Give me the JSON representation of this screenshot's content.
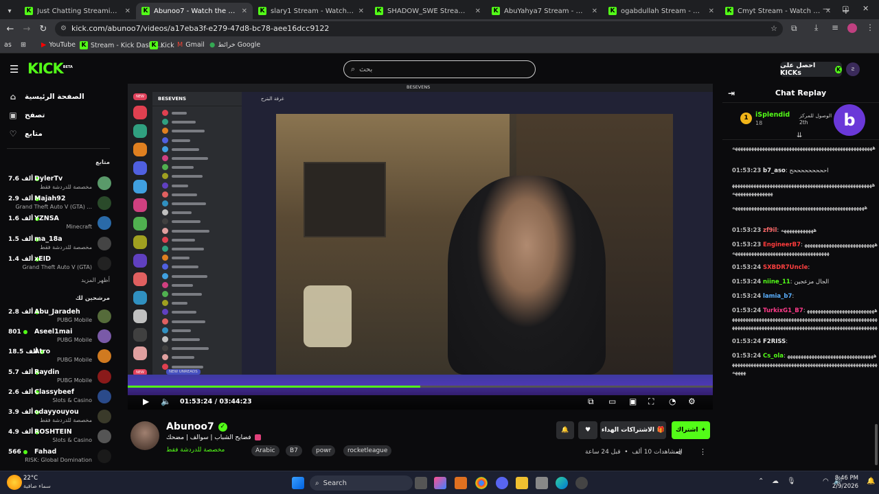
{
  "browser": {
    "tabs": [
      {
        "label": "Just Chatting Streaming - Live S",
        "active": false
      },
      {
        "label": "Abunoo7 - Watch the VOD on K",
        "active": true
      },
      {
        "label": "slary1 Stream - Watch Live on K",
        "active": false
      },
      {
        "label": "SHADOW_SWE Stream - Watch",
        "active": false
      },
      {
        "label": "AbuYahya7 Stream - Watch Live",
        "active": false
      },
      {
        "label": "ogabdullah Stream - Watch Live",
        "active": false
      },
      {
        "label": "Cmyt Stream - Watch Live on K",
        "active": false
      }
    ],
    "url": "kick.com/abunoo7/videos/a17eba3f-e279-47d8-bc78-aee16dcc9122",
    "bookmarks": [
      "YouTube",
      "Stream - Kick Dashb...",
      "Kick",
      "Gmail",
      "خرائط Google"
    ],
    "profile_short": "as"
  },
  "header": {
    "logo": "KICK",
    "logo_badge": "BETA",
    "search_placeholder": "بحث",
    "get_kicks": "احصل على KICKs"
  },
  "sidebar": {
    "nav": [
      {
        "label": "الصفحة الرئيسية",
        "icon": "home-icon"
      },
      {
        "label": "تصفح",
        "icon": "browse-icon"
      },
      {
        "label": "متابع",
        "icon": "heart-icon"
      }
    ],
    "following_heading": "متابع",
    "following": [
      {
        "name": "DylerTv",
        "count": "7.6 ألف",
        "category": "مخصصة للدردشة فقط",
        "color": "#5a9a6a"
      },
      {
        "name": "Majah92",
        "count": "2.9 ألف",
        "category": "Grand Theft Auto V (GTA) ...",
        "color": "#2a4a2a"
      },
      {
        "name": "YZNSA",
        "count": "1.6 ألف",
        "category": "Minecraft",
        "color": "#2a6aa8"
      },
      {
        "name": "ma_18a",
        "count": "1.5 ألف",
        "category": "مخصصة للدردشة فقط",
        "color": "#444"
      },
      {
        "name": "xEID",
        "count": "1.4 ألف",
        "category": "Grand Theft Auto V (GTA)",
        "color": "#222"
      }
    ],
    "show_more": "أظهر المزيد",
    "recommended_heading": "مرشحين لك",
    "recommended": [
      {
        "name": "Abu_Jaradeh",
        "count": "2.8 ألف",
        "category": "PUBG Mobile",
        "color": "#556b3a"
      },
      {
        "name": "Aseel1mai",
        "count": "801",
        "category": "PUBG Mobile",
        "color": "#7a5aa8"
      },
      {
        "name": "Atro",
        "count": "18.5 ألف",
        "category": "PUBG Mobile",
        "color": "#d07a20"
      },
      {
        "name": "Raydin",
        "count": "5.7 ألف",
        "category": "PUBG Mobile",
        "color": "#8a1a1a"
      },
      {
        "name": "Classybeef",
        "count": "2.6 ألف",
        "category": "Slots & Casino",
        "color": "#2a4a8a"
      },
      {
        "name": "odayyouyou",
        "count": "3.9 ألف",
        "category": "مخصصة للدردشة فقط",
        "color": "#3a3a2a"
      },
      {
        "name": "ROSHTEIN",
        "count": "4.9 ألف",
        "category": "Slots & Casino",
        "color": "#555"
      },
      {
        "name": "Fahad",
        "count": "566",
        "category": "RISK: Global Domination",
        "color": "#1a1a1a"
      }
    ]
  },
  "video": {
    "time_current": "01:53:24",
    "time_total": "03:44:23",
    "progress": 0.5,
    "discord_server": "BESEVENS",
    "discord_window_title": "BESEVENS",
    "discord_channel": "غرفة البترح",
    "new_badge": "NEW",
    "new_unreads": "NEW UNREADS"
  },
  "stream": {
    "name": "Abunoo7",
    "title": "فضايح الشباب | سوالف | مضحك",
    "category": "مخصصة للدردشة فقط",
    "tags": [
      "Arabic",
      "B7",
      "powr",
      "rocketleague"
    ],
    "subscribe_label": "اشتراك",
    "gift_label": "الاشتراكات الهداء",
    "views": "المشاهدات 10 ألف",
    "time_ago": "قبل 24 ساعة"
  },
  "chat": {
    "title": "Chat Replay",
    "pinned": {
      "rank": "1",
      "user": "iSplendid",
      "months": "18",
      "gift_text": "الوصول للمركز",
      "position": "2th"
    },
    "messages": [
      {
        "ts": "",
        "user": "",
        "color": "#ddd",
        "text": "ههههههههههههههههههههههههههههههههههههههههههههههههههههه"
      },
      {
        "ts": "01:53:23",
        "user": "b7_aso",
        "color": "#e8e8e8",
        "text": "احححححححححح"
      },
      {
        "ts": "",
        "user": "",
        "color": "#ddd",
        "text": "هههههههههههههههههههههههههههههههههههههههههههههههههههههههههههههههههههه"
      },
      {
        "ts": "",
        "user": "",
        "color": "#ddd",
        "text": "هههههههههههههههههههههههههههههههههههههههههههههههههه"
      },
      {
        "ts": "01:53:23",
        "user": "zf9il",
        "color": "#ff6b6b",
        "text": "ههههههههههههه"
      },
      {
        "ts": "01:53:23",
        "user": "EngineerB7",
        "color": "#ff3b3b",
        "text": "ههههههههههههههههههههههههههههههههههههههههههههههههههههههههههههههه"
      },
      {
        "ts": "01:53:24",
        "user": "SXBDR7Uncle",
        "color": "#ff4040",
        "text": ""
      },
      {
        "ts": "01:53:24",
        "user": "niine_11",
        "color": "#53fc18",
        "text": "الجال مزعجين"
      },
      {
        "ts": "01:53:24",
        "user": "lamia_b7",
        "color": "#5ab0ff",
        "text": ""
      },
      {
        "ts": "01:53:24",
        "user": "TurkixG1_B7",
        "color": "#ff3b8a",
        "text": "هههههههههههههههههههههههههههههههههههههههههههههههههههههههههههههههههههههههههههههههههههههههههههههههههههههههههههههههههههههههههههههههههههههههههههههههههههههههههههههههههههههههههه"
      },
      {
        "ts": "01:53:24",
        "user": "F2RISS",
        "color": "#e8e8e8",
        "text": ""
      },
      {
        "ts": "01:53:24",
        "user": "Cs_ola",
        "color": "#53fc18",
        "text": "هههههههههههههههههههههههههههههههههههههههههههههههههههههههههههههههههههههههههههههههههههههههههههه"
      }
    ]
  },
  "taskbar": {
    "weather_temp": "22°C",
    "weather_desc": "سماء صافية",
    "search": "Search",
    "time": "8:46 PM",
    "date": "2/9/2026"
  }
}
